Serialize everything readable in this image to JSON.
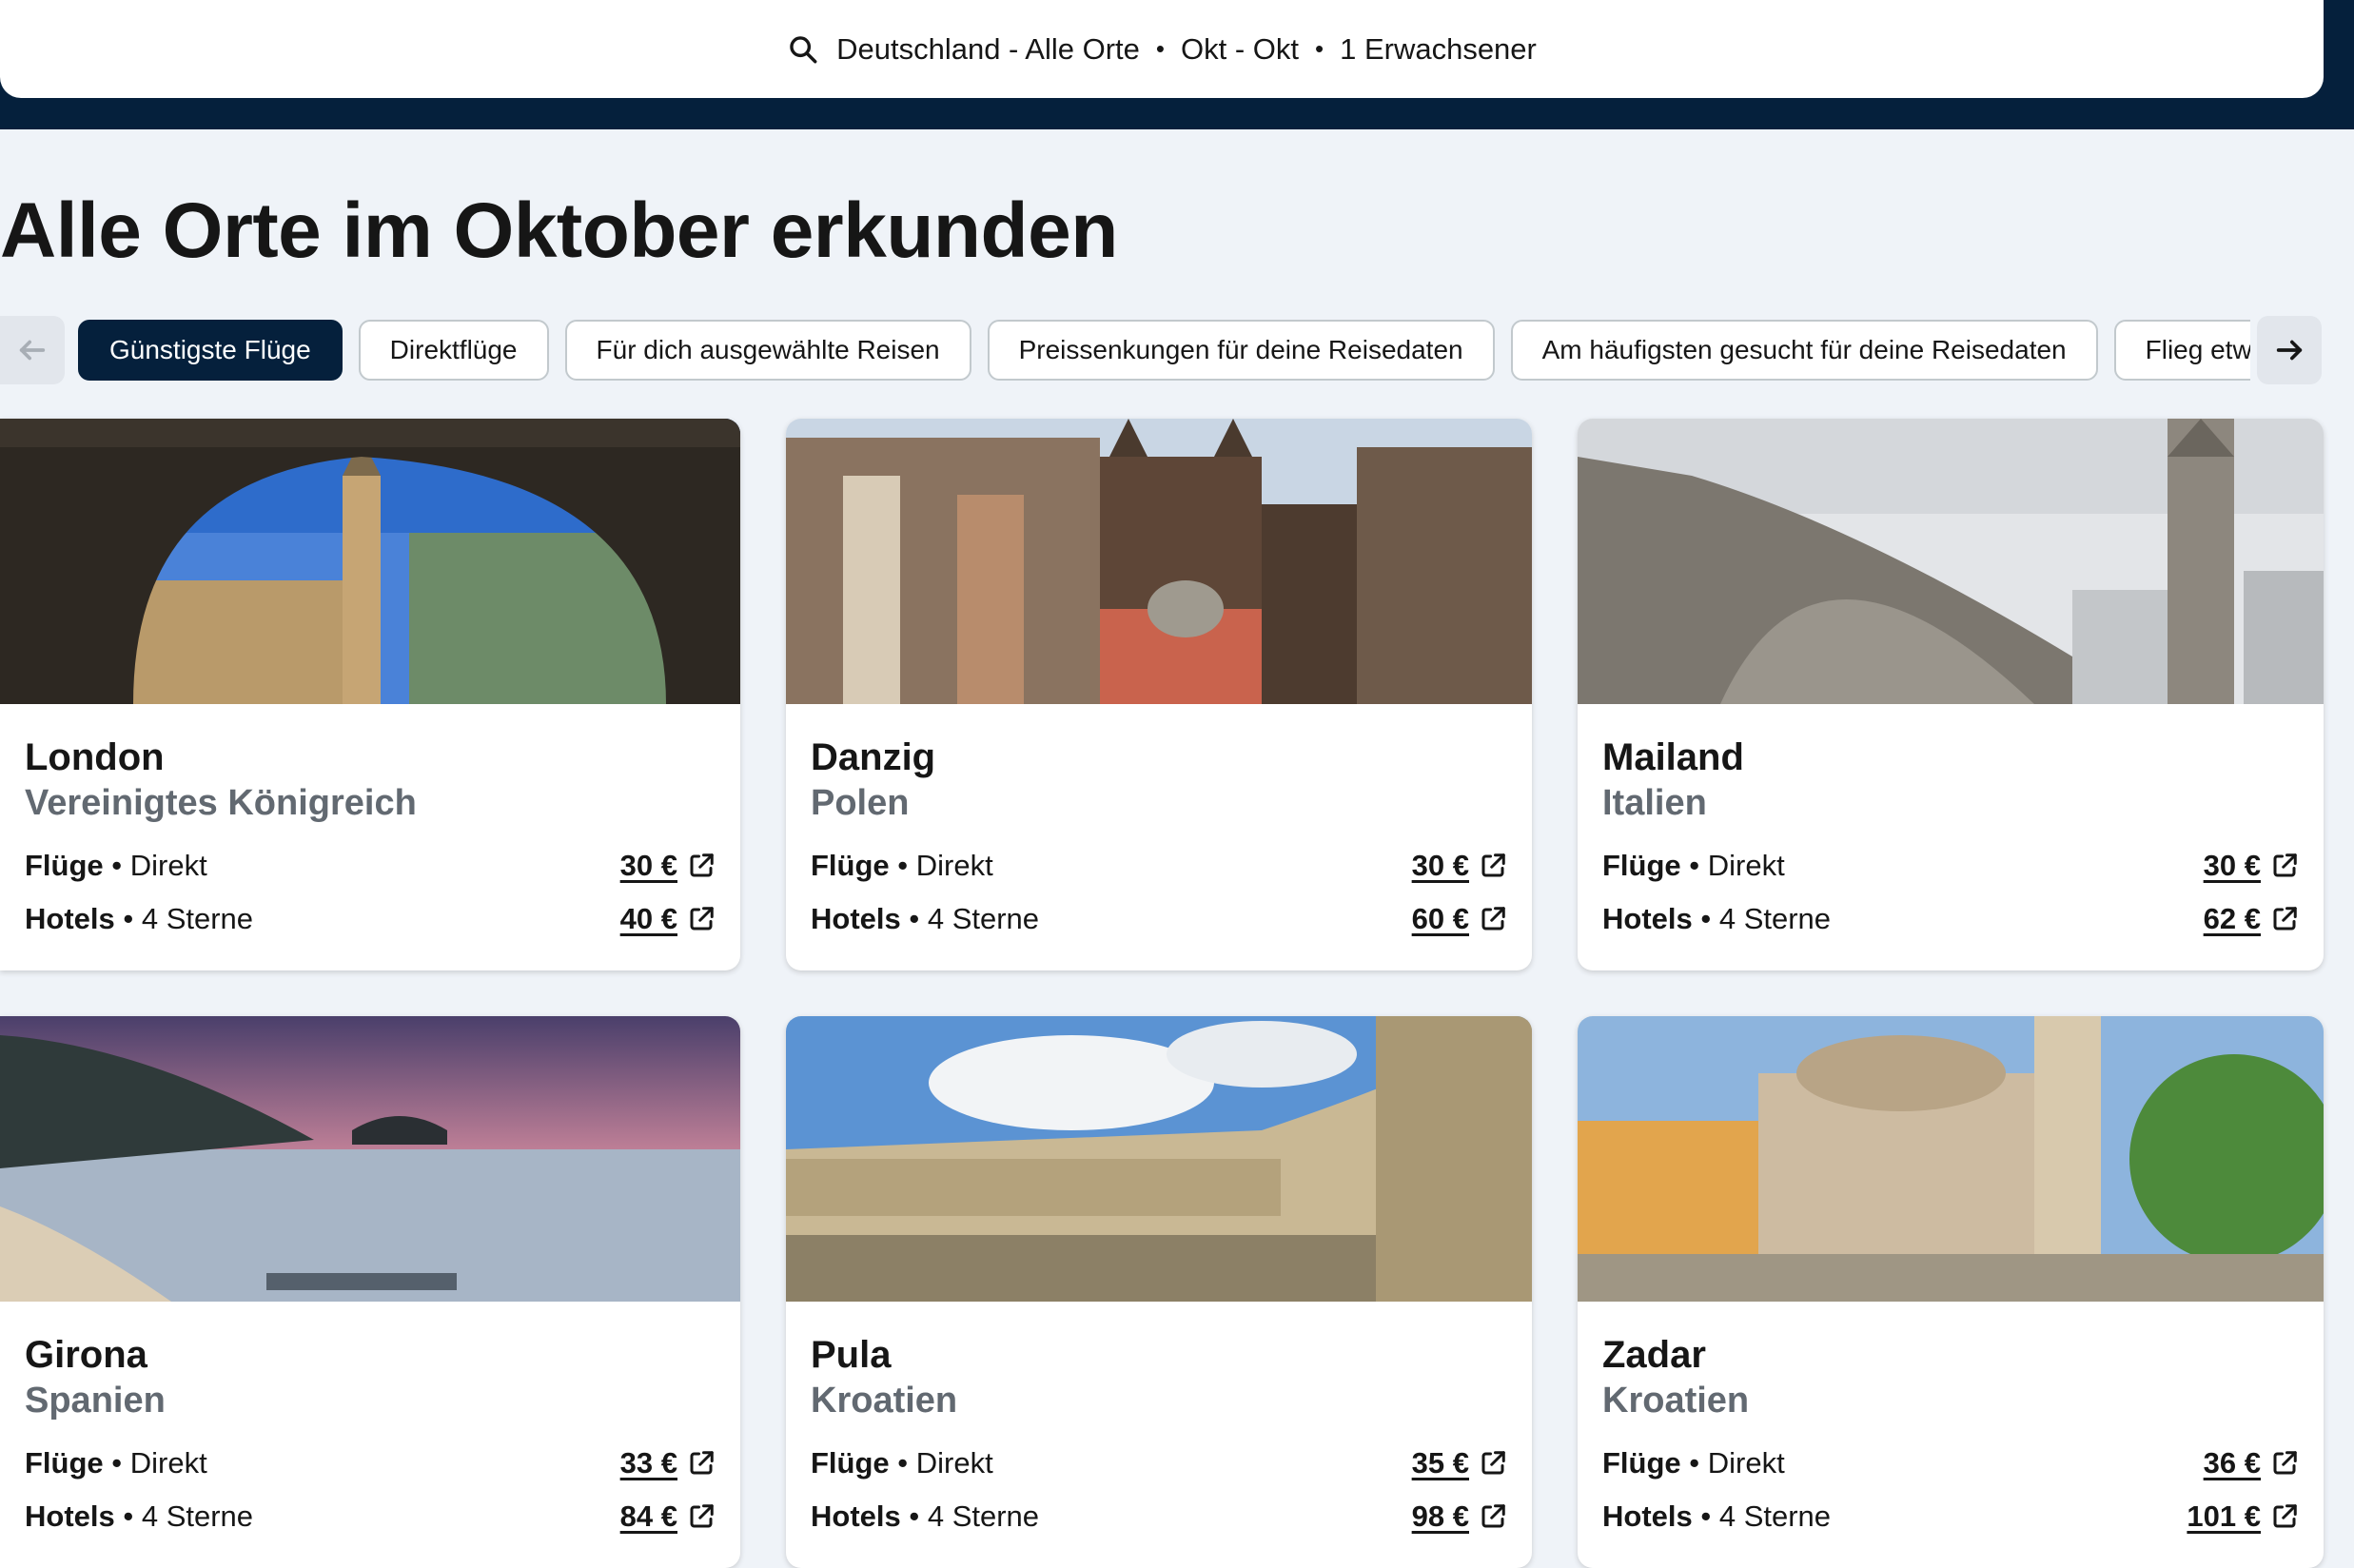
{
  "search": {
    "destination": "Deutschland - Alle Orte",
    "dates": "Okt - Okt",
    "travellers": "1 Erwachsener",
    "separator": "•"
  },
  "title": "Alle Orte im Oktober erkunden",
  "chips": [
    {
      "label": "Günstigste Flüge",
      "active": true
    },
    {
      "label": "Direktflüge",
      "active": false
    },
    {
      "label": "Für dich ausgewählte Reisen",
      "active": false
    },
    {
      "label": "Preissenkungen für deine Reisedaten",
      "active": false
    },
    {
      "label": "Am häufigsten gesucht für deine Reisedaten",
      "active": false
    },
    {
      "label": "Flieg etwa",
      "active": false
    }
  ],
  "cards": [
    {
      "city": "London",
      "country": "Vereinigtes Königreich",
      "flights_label": "Flüge",
      "flights_type": "Direkt",
      "flights_price": "30 €",
      "hotels_label": "Hotels",
      "hotels_type": "4 Sterne",
      "hotels_price": "40 €"
    },
    {
      "city": "Danzig",
      "country": "Polen",
      "flights_label": "Flüge",
      "flights_type": "Direkt",
      "flights_price": "30 €",
      "hotels_label": "Hotels",
      "hotels_type": "4 Sterne",
      "hotels_price": "60 €"
    },
    {
      "city": "Mailand",
      "country": "Italien",
      "flights_label": "Flüge",
      "flights_type": "Direkt",
      "flights_price": "30 €",
      "hotels_label": "Hotels",
      "hotels_type": "4 Sterne",
      "hotels_price": "62 €"
    },
    {
      "city": "Girona",
      "country": "Spanien",
      "flights_label": "Flüge",
      "flights_type": "Direkt",
      "flights_price": "33 €",
      "hotels_label": "Hotels",
      "hotels_type": "4 Sterne",
      "hotels_price": "84 €"
    },
    {
      "city": "Pula",
      "country": "Kroatien",
      "flights_label": "Flüge",
      "flights_type": "Direkt",
      "flights_price": "35 €",
      "hotels_label": "Hotels",
      "hotels_type": "4 Sterne",
      "hotels_price": "98 €"
    },
    {
      "city": "Zadar",
      "country": "Kroatien",
      "flights_label": "Flüge",
      "flights_type": "Direkt",
      "flights_price": "36 €",
      "hotels_label": "Hotels",
      "hotels_type": "4 Sterne",
      "hotels_price": "101 €"
    }
  ],
  "colors": {
    "brand_navy": "#05203c",
    "background": "#eff3f8",
    "muted_text": "#626971"
  },
  "icons": {
    "search": "search-icon",
    "prev": "arrow-left-icon",
    "next": "arrow-right-icon",
    "price_link": "external-link-icon"
  }
}
